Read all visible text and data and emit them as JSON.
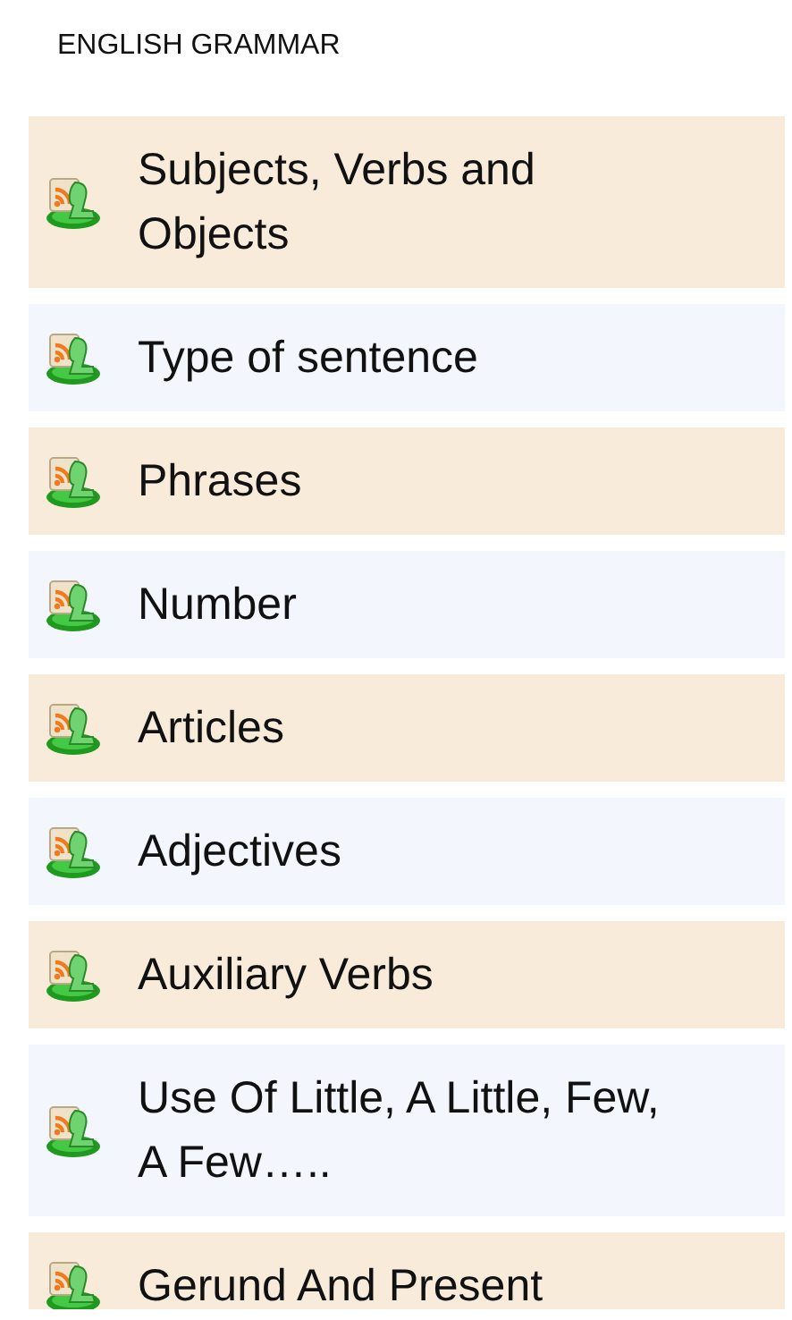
{
  "header": {
    "title": "ENGLISH GRAMMAR"
  },
  "topics": [
    {
      "label": "Subjects, Verbs and Objects"
    },
    {
      "label": "Type of sentence"
    },
    {
      "label": "Phrases"
    },
    {
      "label": "Number"
    },
    {
      "label": "Articles"
    },
    {
      "label": "Adjectives"
    },
    {
      "label": "Auxiliary Verbs"
    },
    {
      "label": "Use Of Little, A Little, Few, A Few….."
    },
    {
      "label": "Gerund And Present"
    }
  ]
}
